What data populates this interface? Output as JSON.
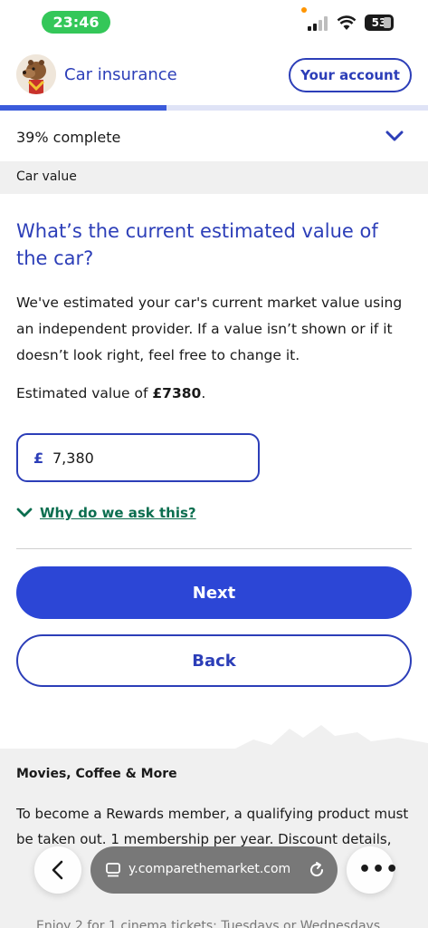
{
  "status_bar": {
    "time": "23:46",
    "battery": "53"
  },
  "header": {
    "title": "Car insurance",
    "account_label": "Your account"
  },
  "progress": {
    "text": "39% complete",
    "fraction": 0.39
  },
  "section": {
    "label": "Car value"
  },
  "main": {
    "question": "What’s the current estimated value of the car?",
    "description": "We've estimated your car's current market value using an independent provider. If a value isn’t shown or if it doesn’t look right, feel free to change it.",
    "estimate_prefix": "Estimated value of ",
    "estimate_value": "£7380",
    "estimate_suffix": ".",
    "currency_symbol": "£",
    "value": "7,380",
    "why_link": "Why do we ask this?",
    "next_label": "Next",
    "back_label": "Back"
  },
  "promo": {
    "title": "Movies, Coffee & More",
    "text": "To become a Rewards member, a qualifying product must be taken out. 1 membership per year. Discount details,",
    "bullet": "Enjoy 2 for 1 cinema tickets: Tuesdays or Wednesdays"
  },
  "browser": {
    "url": "y.comparethemarket.com"
  },
  "colors": {
    "brand_blue": "#2c3eb8",
    "button_blue": "#2c46d6",
    "link_green": "#0b6e4f",
    "status_green": "#34c759"
  }
}
